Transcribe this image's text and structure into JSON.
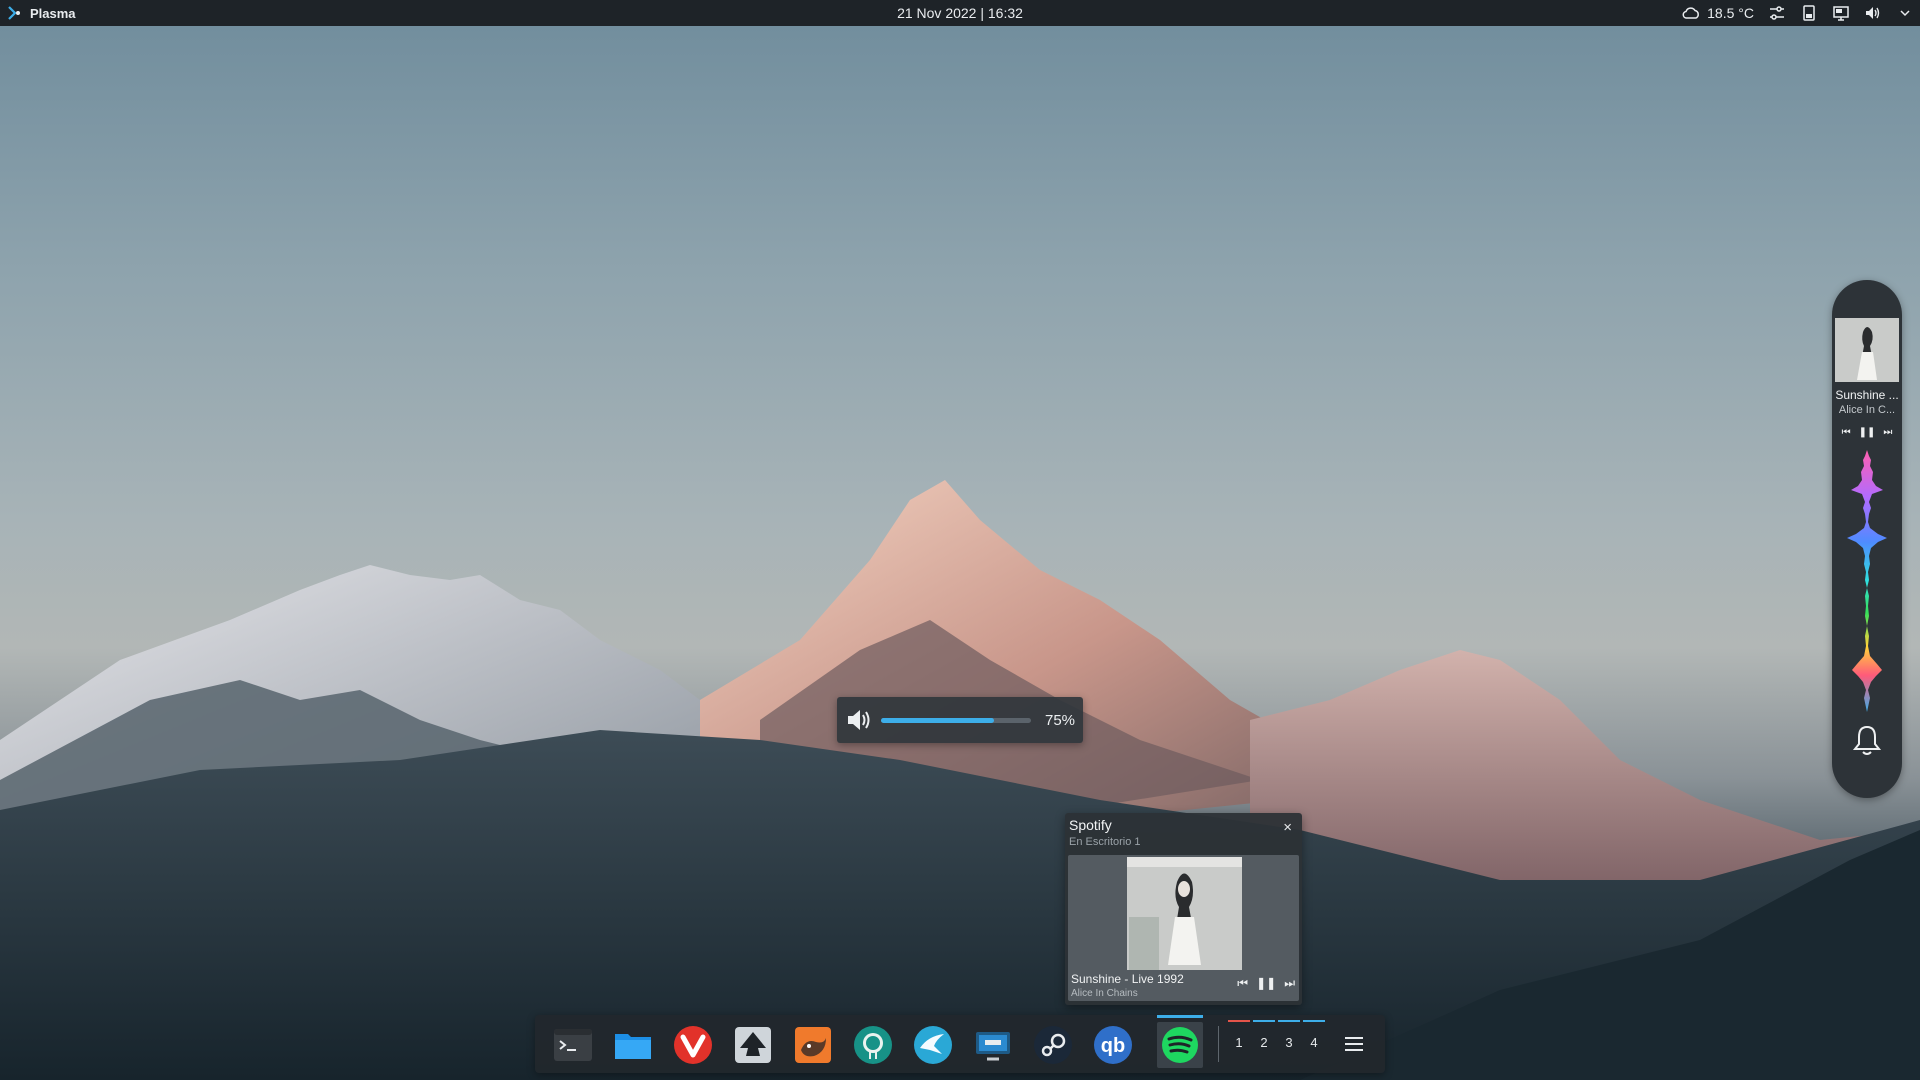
{
  "topbar": {
    "app_title": "Plasma",
    "datetime": "21 Nov 2022 | 16:32",
    "weather": "18.5 °C",
    "icons": [
      "plasma-logo-icon",
      "cloud-icon",
      "settings-sliders-icon",
      "device-icon",
      "display-icon",
      "volume-icon",
      "chevron-down-icon"
    ]
  },
  "volume_osd": {
    "level_percent": 75,
    "label": "75%",
    "icon": "speaker-icon",
    "accent": "#3daee9"
  },
  "notification": {
    "app": "Spotify",
    "subtitle": "En Escritorio 1",
    "song": "Sunshine - Live 1992",
    "artist": "Alice In Chains",
    "close_symbol": "×",
    "controls": [
      "⏮",
      "❚❚",
      "⏭"
    ]
  },
  "side_player": {
    "song": "Sunshine ...",
    "artist": "Alice In C...",
    "controls": [
      "⏮",
      "❚❚",
      "⏭"
    ],
    "icons": [
      "album-art",
      "visualizer",
      "bell-icon"
    ]
  },
  "dock": {
    "apps": [
      {
        "name": "terminal",
        "icon": "terminal-icon"
      },
      {
        "name": "files",
        "icon": "folder-icon"
      },
      {
        "name": "vivaldi",
        "icon": "vivaldi-icon"
      },
      {
        "name": "inkscape",
        "icon": "inkscape-icon"
      },
      {
        "name": "gimp",
        "icon": "gimp-icon"
      },
      {
        "name": "gitkraken",
        "icon": "gitkraken-icon"
      },
      {
        "name": "kdeconnect",
        "icon": "bird-icon"
      },
      {
        "name": "remote-desktop",
        "icon": "monitor-icon"
      },
      {
        "name": "steam",
        "icon": "steam-icon"
      },
      {
        "name": "qbittorrent",
        "icon": "qbittorrent-icon"
      },
      {
        "name": "spotify",
        "icon": "spotify-icon",
        "active": true
      }
    ],
    "desktops": [
      "1",
      "2",
      "3",
      "4"
    ],
    "menu_icon": "hamburger-menu-icon"
  }
}
